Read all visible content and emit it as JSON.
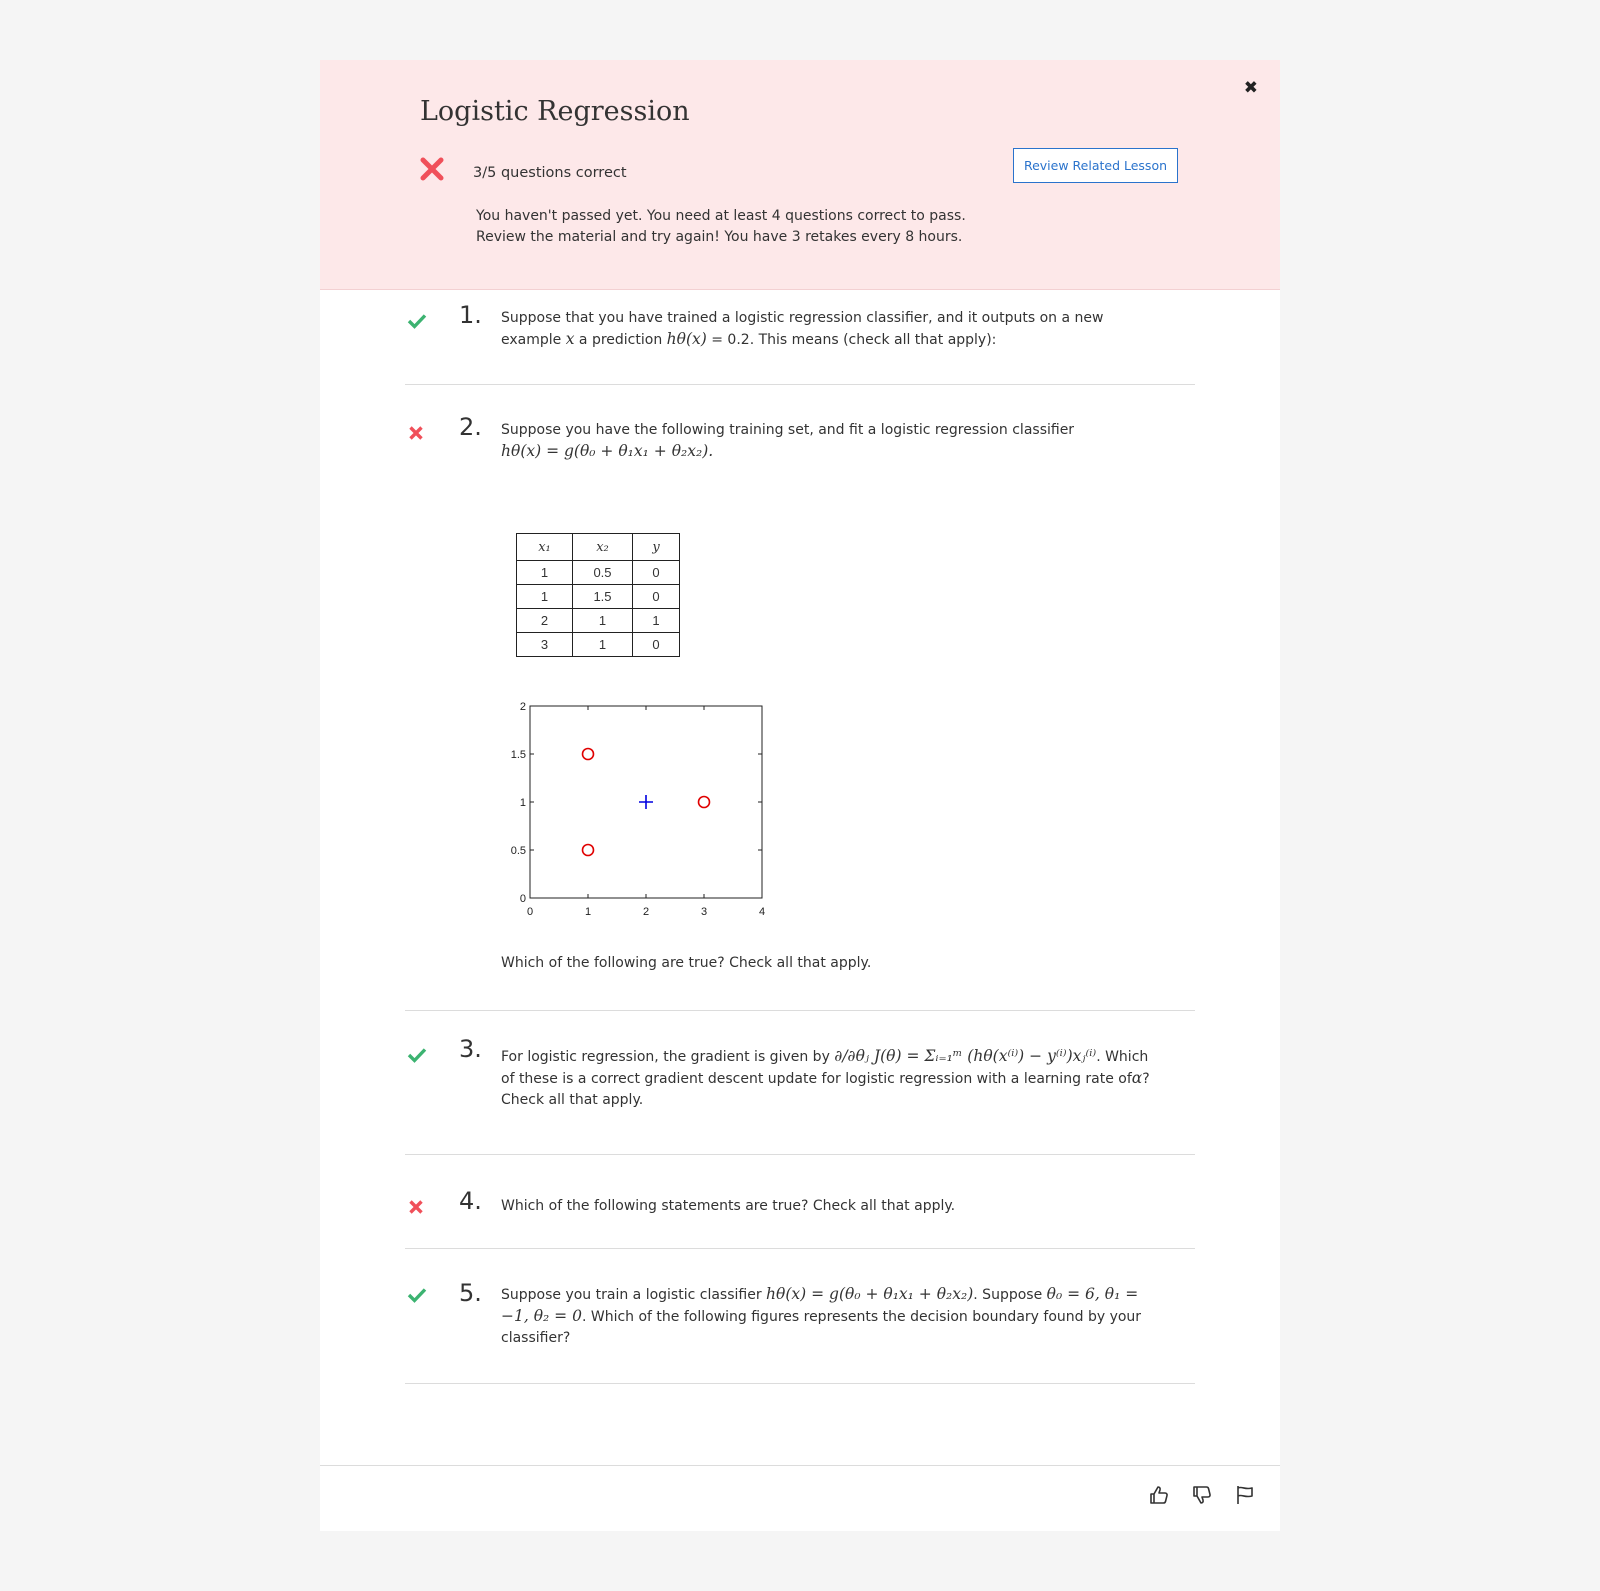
{
  "quiz": {
    "title": "Logistic Regression",
    "score": "3/5 questions correct",
    "review_button": "Review Related Lesson",
    "message_line1": "You haven't passed yet. You need at least 4 questions correct to pass.",
    "message_line2": "Review the material and try again! You have 3 retakes every 8 hours."
  },
  "questions": [
    {
      "number": "1.",
      "status": "correct",
      "t1": "Suppose that you have trained a logistic regression classifier, and it outputs on a new example ",
      "m1": "x",
      "t2": " a prediction ",
      "m2": "hθ(x)",
      "t3": " = 0.2. This means (check all that apply):"
    },
    {
      "number": "2.",
      "status": "incorrect",
      "t1": "Suppose you have the following training set, and fit a logistic regression classifier",
      "m1": "hθ(x) = g(θ₀ + θ₁x₁ + θ₂x₂).",
      "table": {
        "headers": [
          "x₁",
          "x₂",
          "y"
        ],
        "rows": [
          [
            "1",
            "0.5",
            "0"
          ],
          [
            "1",
            "1.5",
            "0"
          ],
          [
            "2",
            "1",
            "1"
          ],
          [
            "3",
            "1",
            "0"
          ]
        ]
      },
      "after": "Which of the following are true? Check all that apply."
    },
    {
      "number": "3.",
      "status": "correct",
      "t1": "For logistic regression, the gradient is given by ",
      "m1": "∂/∂θⱼ J(θ) = Σᵢ₌₁ᵐ (hθ(x⁽ⁱ⁾) − y⁽ⁱ⁾)xⱼ⁽ⁱ⁾",
      "t2": ". Which of these is a correct gradient descent update for logistic regression with a learning rate of",
      "m2": "α",
      "t3": "? Check all that apply."
    },
    {
      "number": "4.",
      "status": "incorrect",
      "t1": "Which of the following statements are true? Check all that apply."
    },
    {
      "number": "5.",
      "status": "correct",
      "t1": "Suppose you train a logistic classifier ",
      "m1": "hθ(x) = g(θ₀ + θ₁x₁ + θ₂x₂)",
      "t2": ". Suppose ",
      "m2": "θ₀ = 6, θ₁ = −1, θ₂ = 0",
      "t3": ". Which of the following figures represents the decision boundary found by your classifier?"
    }
  ],
  "chart_data": {
    "type": "scatter",
    "xlim": [
      0,
      4
    ],
    "ylim": [
      0,
      2
    ],
    "x_ticks": [
      "0",
      "1",
      "2",
      "3",
      "4"
    ],
    "y_ticks": [
      "0",
      "0.5",
      "1",
      "1.5",
      "2"
    ],
    "series": [
      {
        "marker": "circle",
        "color": "#e00000",
        "points": [
          [
            1,
            0.5
          ],
          [
            1,
            1.5
          ],
          [
            3,
            1
          ]
        ]
      },
      {
        "marker": "plus",
        "color": "#0000e0",
        "points": [
          [
            2,
            1
          ]
        ]
      }
    ]
  },
  "colors": {
    "correct": "#3cb371",
    "incorrect": "#f0505a",
    "link": "#2a73cc",
    "banner": "#fde8e9"
  },
  "icons": [
    "close-icon",
    "fail-x-icon",
    "check-icon",
    "cross-icon",
    "thumbs-up-icon",
    "thumbs-down-icon",
    "flag-icon"
  ]
}
